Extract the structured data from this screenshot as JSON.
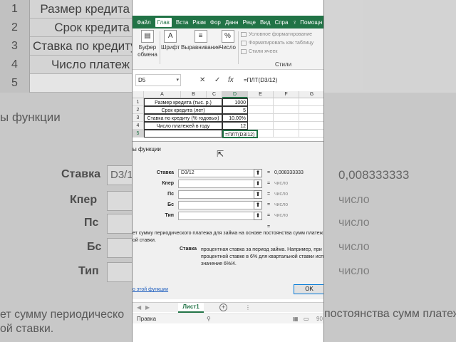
{
  "background": {
    "rows": [
      {
        "num": "1",
        "text": "Размер кредита"
      },
      {
        "num": "2",
        "text": "Срок кредита"
      },
      {
        "num": "3",
        "text": "Ставка по кредиту"
      },
      {
        "num": "4",
        "text": "Число платеж"
      },
      {
        "num": "5",
        "text": ""
      }
    ],
    "dialog_title": "ы функции",
    "labels": {
      "stavka": "Ставка",
      "kper": "Кпер",
      "ps": "Пс",
      "bs": "Бс",
      "tip": "Тип"
    },
    "field_value": "D3/1",
    "result_value": "0,008333333",
    "result_placeholder": "число",
    "bottom_left_1": "ет сумму периодическо",
    "bottom_left_2": "ой ставки.",
    "bottom_right": "постоянства сумм платеж"
  },
  "ribbon": {
    "tabs": [
      "Файл",
      "Глав",
      "Вста",
      "Разм",
      "Фор",
      "Данн",
      "Реце",
      "Вид",
      "Спра",
      "Помощн"
    ],
    "active_tab": "Глав",
    "groups": {
      "clipboard": "Буфер обмена",
      "font": "Шрифт",
      "alignment": "Выравнивание",
      "number": "Число"
    },
    "styles": {
      "conditional": "Условное форматирование",
      "format_table": "Форматировать как таблицу",
      "cell_styles": "Стили ячеек",
      "group_label": "Стили"
    }
  },
  "formula_bar": {
    "name_box": "D5",
    "cancel": "✕",
    "enter": "✓",
    "fx": "fx",
    "formula": "=ПЛТ(D3/12)"
  },
  "grid": {
    "columns": [
      "A",
      "B",
      "C",
      "D",
      "E",
      "F",
      "G"
    ],
    "rows": [
      "1",
      "2",
      "3",
      "4",
      "5"
    ],
    "labels": [
      "Размер кредита (тыс. р.)",
      "Срок кредита (лет)",
      "Ставка по кредиту (% годовых)",
      "Число платежей в году"
    ],
    "values": [
      "1000",
      "5",
      "10,00%",
      "12"
    ],
    "active_cell_text": "=ПЛТ(D3/12)"
  },
  "dialog": {
    "title": "ы функции",
    "args": [
      {
        "label": "Ставка",
        "value": "D3/12",
        "result": "0,008333333"
      },
      {
        "label": "Кпер",
        "value": "",
        "result": "число"
      },
      {
        "label": "Пс",
        "value": "",
        "result": "число"
      },
      {
        "label": "Бс",
        "value": "",
        "result": "число"
      },
      {
        "label": "Тип",
        "value": "",
        "result": "число"
      }
    ],
    "eq_sign": "=",
    "description_line1": "ет сумму периодического платежа для займа на основе постоянства сумм платеж",
    "description_line2": "ой ставки.",
    "arg_head": "Ставка",
    "arg_desc": "процентная ставка за период займа. Например, при процентной ставке в 6% для квартальной ставки исп значение 6%/4.",
    "help_link": "о этой функции",
    "ok_button": "OK"
  },
  "sheets": {
    "active": "Лист1",
    "add": "+",
    "dots": "⋮"
  },
  "status": {
    "mode": "Правка",
    "zoom": "90"
  },
  "colors": {
    "excel_green": "#217346",
    "link_blue": "#1f5fbf"
  }
}
